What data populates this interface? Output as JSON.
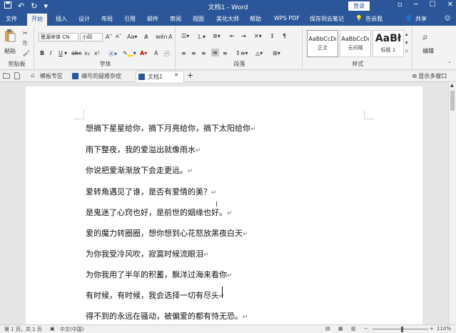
{
  "titlebar": {
    "title": "文档1 - Word",
    "login_label": "登录",
    "quick_access": [
      "save-icon",
      "undo-icon",
      "redo-icon",
      "customize-icon"
    ],
    "window_controls": [
      "ribbon-display-icon",
      "minimize-icon",
      "maximize-icon",
      "close-icon"
    ]
  },
  "ribbon_tabs": [
    "文件",
    "开始",
    "插入",
    "设计",
    "布局",
    "引用",
    "邮件",
    "审阅",
    "视图",
    "美化大师",
    "帮助",
    "WPS PDF",
    "保存到云笔记",
    "告诉我",
    "共享"
  ],
  "active_tab": "开始",
  "ribbon": {
    "clipboard": {
      "paste_label": "粘贴",
      "group_label": "剪贴板"
    },
    "font": {
      "font_name": "思源宋体 CN",
      "font_size": "小四",
      "group_label": "字体",
      "case_label": "Aa",
      "grow_label": "A",
      "shrink_label": "A"
    },
    "paragraph": {
      "group_label": "段落"
    },
    "styles": {
      "group_label": "样式",
      "items": [
        {
          "sample": "AaBbCcDı",
          "name": "正文"
        },
        {
          "sample": "AaBbCcDı",
          "name": "无间隔"
        },
        {
          "sample": "AaBł",
          "name": "标题 1"
        }
      ]
    },
    "editing": {
      "label": "编辑"
    }
  },
  "doc_tabs": [
    {
      "label": "模板专区",
      "icon": "template-icon",
      "active": false
    },
    {
      "label": "编号的疑难杂症",
      "icon": "word-doc-icon",
      "active": false
    },
    {
      "label": "文档1",
      "icon": "word-doc-icon",
      "active": true
    }
  ],
  "show_windows_label": "显示多窗口",
  "document": {
    "lines": [
      "想摘下星星给你，摘下月亮给你，摘下太阳给你",
      "雨下整夜，我的爱溢出就像雨水",
      "你说把爱渐渐放下会走更远。",
      "爱转角遇见了谁，是否有爱情的美？",
      "是鬼迷了心窍也好，是前世的姻缘也好。",
      "爱的魔力转圈圈，想你想到心花怒放黑夜白天",
      "为你我受冷风吹，寂寞时候流眼泪",
      "为你我用了半年的积蓄，飘洋过海来看你",
      "有时候，有时候，我会选择一切有尽头",
      "得不到的永远在骚动，被偏爱的都有恃无恐。"
    ],
    "paragraph_mark": "↵"
  },
  "statusbar": {
    "page_info": "第 1 页，共 1 页",
    "language": "中文(中国)",
    "zoom_out": "−",
    "zoom_in": "+",
    "zoom_level": "110%"
  },
  "colors": {
    "accent": "#2b579a",
    "highlight": "#ffd200",
    "font_color": "#c00000"
  }
}
